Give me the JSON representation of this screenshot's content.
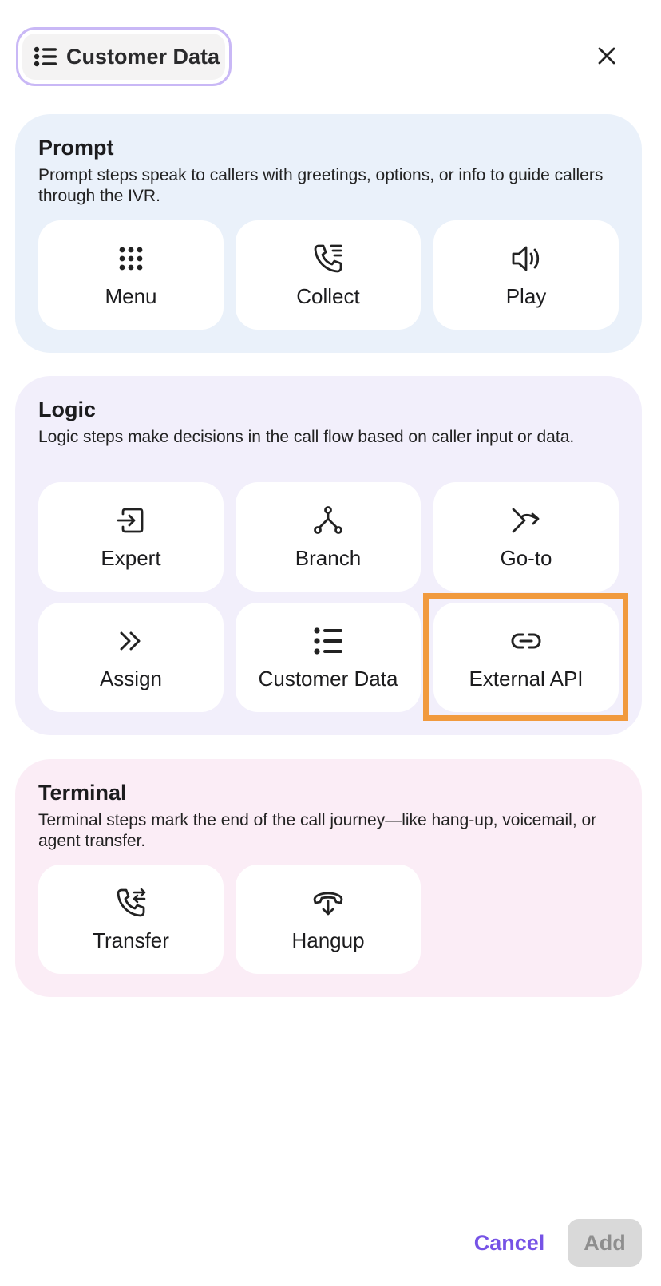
{
  "header": {
    "selected_label": "Customer Data",
    "selected_icon": "list-icon",
    "close_icon": "close-icon"
  },
  "sections": [
    {
      "title": "Prompt",
      "description": "Prompt steps speak to callers with greetings, options, or info to guide callers through the IVR.",
      "color": "#eaf1fa",
      "items": [
        {
          "label": "Menu",
          "icon": "keypad-icon"
        },
        {
          "label": "Collect",
          "icon": "phone-collect-icon"
        },
        {
          "label": "Play",
          "icon": "speaker-icon"
        }
      ]
    },
    {
      "title": "Logic",
      "description": "Logic steps make decisions in the call flow based on caller input or data.",
      "color": "#f2effb",
      "items": [
        {
          "label": "Expert",
          "icon": "expert-enter-icon"
        },
        {
          "label": "Branch",
          "icon": "branch-icon"
        },
        {
          "label": "Go-to",
          "icon": "goto-arrow-icon"
        },
        {
          "label": "Assign",
          "icon": "double-chevron-icon"
        },
        {
          "label": "Customer Data",
          "icon": "list-icon"
        },
        {
          "label": "External API",
          "icon": "link-icon"
        }
      ]
    },
    {
      "title": "Terminal",
      "description": "Terminal steps mark the end of the call journey—like hang-up, voicemail, or agent transfer.",
      "color": "#fbedf6",
      "items": [
        {
          "label": "Transfer",
          "icon": "phone-transfer-icon"
        },
        {
          "label": "Hangup",
          "icon": "phone-hangup-icon"
        }
      ]
    }
  ],
  "highlighted_item": "External API",
  "highlight_color": "#f19a3e",
  "footer": {
    "cancel_label": "Cancel",
    "add_label": "Add",
    "cancel_color": "#7653e6"
  }
}
